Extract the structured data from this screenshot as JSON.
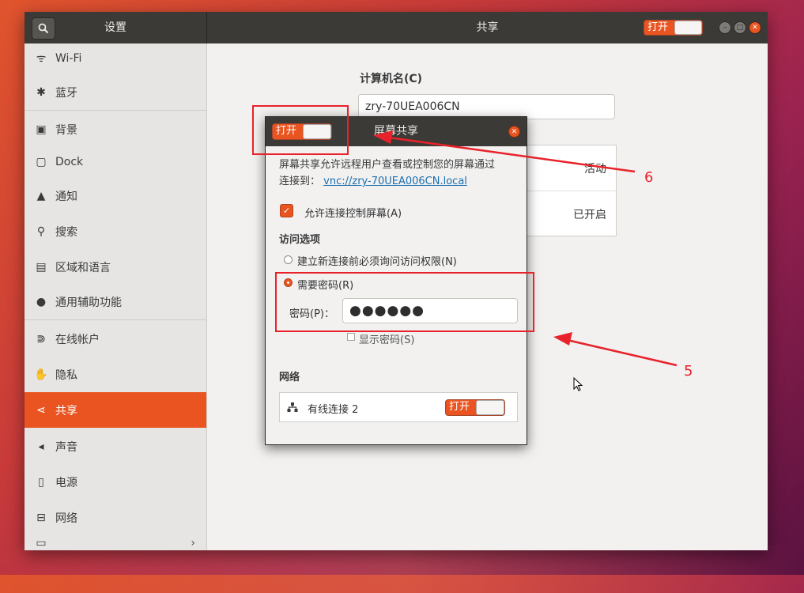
{
  "colors": {
    "accent": "#e95420",
    "header": "#3b3a36",
    "annotation": "#e8222a"
  },
  "window": {
    "header_left_title": "设置",
    "header_center_title": "共享",
    "master_switch_label": "打开"
  },
  "sidebar": {
    "items": [
      {
        "label": "Wi-Fi",
        "icon": "wifi-icon"
      },
      {
        "label": "蓝牙",
        "icon": "bluetooth-icon"
      },
      {
        "label": "背景",
        "icon": "background-icon"
      },
      {
        "label": "Dock",
        "icon": "dock-icon"
      },
      {
        "label": "通知",
        "icon": "bell-icon"
      },
      {
        "label": "搜索",
        "icon": "search-icon"
      },
      {
        "label": "区域和语言",
        "icon": "region-icon"
      },
      {
        "label": "通用辅助功能",
        "icon": "accessibility-icon"
      },
      {
        "label": "在线帐户",
        "icon": "online-accounts-icon"
      },
      {
        "label": "隐私",
        "icon": "privacy-icon"
      },
      {
        "label": "共享",
        "icon": "share-icon",
        "active": true
      },
      {
        "label": "声音",
        "icon": "sound-icon"
      },
      {
        "label": "电源",
        "icon": "power-icon"
      },
      {
        "label": "网络",
        "icon": "network-icon"
      }
    ]
  },
  "content": {
    "hostname_label": "计算机名(C)",
    "hostname_value": "zry-70UEA006CN",
    "rows": [
      {
        "status": "活动"
      },
      {
        "status": "已开启"
      }
    ]
  },
  "dialog": {
    "title": "屏幕共享",
    "switch_label": "打开",
    "description": "屏幕共享允许远程用户查看或控制您的屏幕通过",
    "connect_prefix": "连接到：",
    "connect_link": "vnc://zry-70UEA006CN.local",
    "allow_control_label": "允许连接控制屏幕(A)",
    "access_title": "访问选项",
    "option_ask": "建立新连接前必须询问访问权限(N)",
    "option_password": "需要密码(R)",
    "password_label": "密码(P)：",
    "password_value": "●●●●●●",
    "show_password_label": "显示密码(S)",
    "network_title": "网络",
    "network_item": "有线连接 2",
    "network_switch_label": "打开"
  },
  "annotations": {
    "label_6": "6",
    "label_5": "5"
  }
}
